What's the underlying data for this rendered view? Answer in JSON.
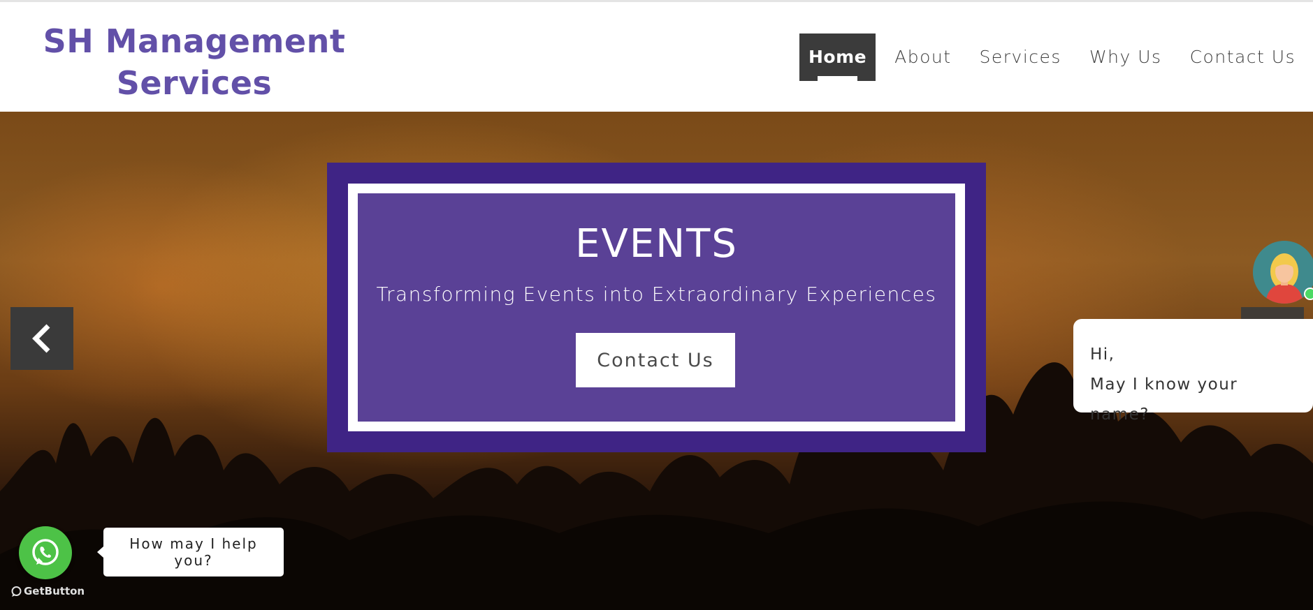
{
  "header": {
    "brand": "SH Management Services",
    "nav": [
      {
        "label": "Home",
        "active": true
      },
      {
        "label": "About"
      },
      {
        "label": "Services"
      },
      {
        "label": "Why Us"
      },
      {
        "label": "Contact Us"
      }
    ]
  },
  "hero": {
    "title": "EVENTS",
    "subtitle": "Transforming Events into Extraordinary Experiences",
    "cta_label": "Contact Us",
    "prev_icon": "chevron-left-icon"
  },
  "chat": {
    "greeting_line1": "Hi,",
    "greeting_line2": "May I know your name?",
    "status": "online"
  },
  "whatsapp": {
    "tooltip": "How may I help you?",
    "branding": "GetButton"
  },
  "colors": {
    "brand": "#6250a8",
    "nav_active_bg": "#3b3b3b",
    "event_outer": "#3f2485",
    "event_inner": "#5a4196",
    "whatsapp_green": "#4dc247"
  }
}
